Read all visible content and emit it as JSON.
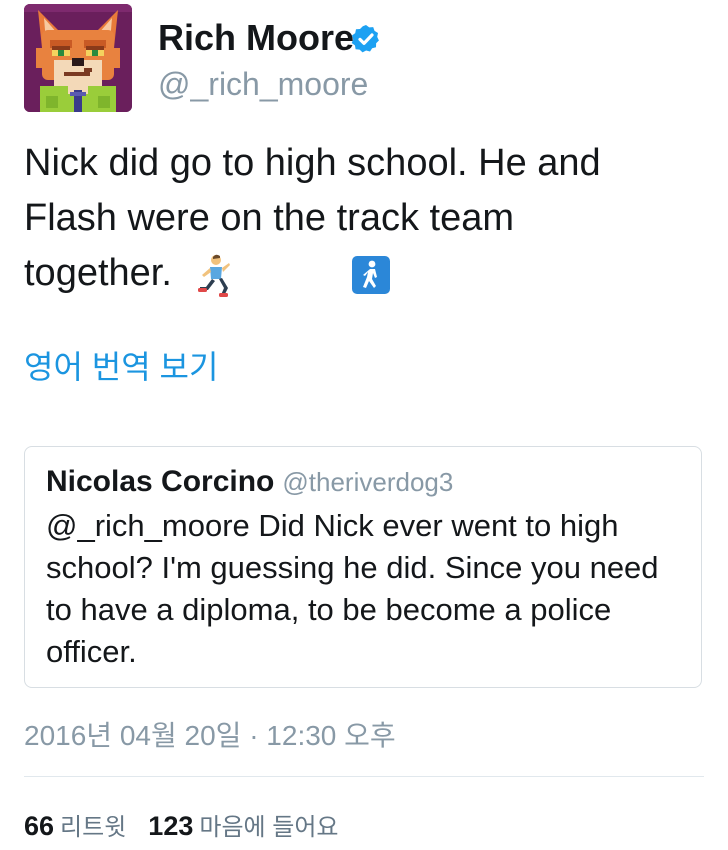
{
  "author": {
    "display_name": "Rich Moore",
    "handle": "@_rich_moore",
    "verified": true,
    "avatar_icon": "fox-pixel-avatar"
  },
  "tweet": {
    "text_lines": [
      "Nick did go to high school. He and",
      "Flash were on the track team",
      "together."
    ],
    "emojis": [
      "runner-emoji",
      "pedestrian-emoji"
    ]
  },
  "translate_link": "영어 번역 보기",
  "quoted_tweet": {
    "author_name": "Nicolas Corcino",
    "author_handle": "@theriverdog3",
    "text_lines": [
      "@_rich_moore Did Nick ever went to high",
      "school? I'm guessing he did. Since you need",
      "to have a diploma, to be become a police",
      "officer."
    ]
  },
  "timestamp": "2016년 04월 20일 · 12:30 오후",
  "stats": {
    "retweets_count": "66",
    "retweets_label": "리트윗",
    "likes_count": "123",
    "likes_label": "마음에 들어요"
  },
  "colors": {
    "link": "#1b95e0",
    "muted": "#8899a6",
    "verified": "#1da1f2",
    "text": "#14171a"
  }
}
